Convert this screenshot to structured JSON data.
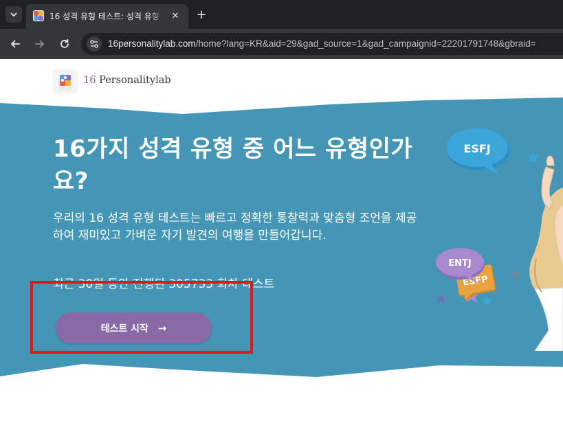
{
  "browser": {
    "tab_title": "16 성격 유형 테스트: 성격 유형",
    "url_host": "16personalitylab.com",
    "url_path": "/home?lang=KR&aid=29&gad_source=1&gad_campaignid=22201791748&gbraid=",
    "new_tab_label": "+",
    "close_label": "✕"
  },
  "header": {
    "brand_number": "16",
    "brand_name": "Personalitylab"
  },
  "hero": {
    "title": "16가지 성격 유형 중 어느 유형인가요?",
    "description": "우리의 16 성격 유형 테스트는 빠르고 정확한 통찰력과 맞춤형 조언을 제공하여 재미있고 가벼운 자기 발견의 여행을 만들어갑니다.",
    "count_text": "최근 30일 동안 진행된 305733 회차 테스트",
    "start_button_label": "테스트 시작",
    "start_button_arrow": "→"
  },
  "bubbles": {
    "esfj": "ESFJ",
    "esfp": "ESFP",
    "entj": "ENTJ"
  },
  "colors": {
    "hero_bg": "#4596b6",
    "button": "#8a6aa6",
    "highlight": "#e8141b",
    "bubble_blue": "#3ba6d9",
    "bubble_orange": "#e8a340",
    "bubble_purple": "#a98ad0"
  },
  "icons": {
    "tab_menu": "chevron-down-icon",
    "back": "arrow-left-icon",
    "forward": "arrow-right-icon",
    "reload": "reload-icon",
    "site_info": "tune-icon",
    "favicon": "puzzle-head-icon"
  }
}
